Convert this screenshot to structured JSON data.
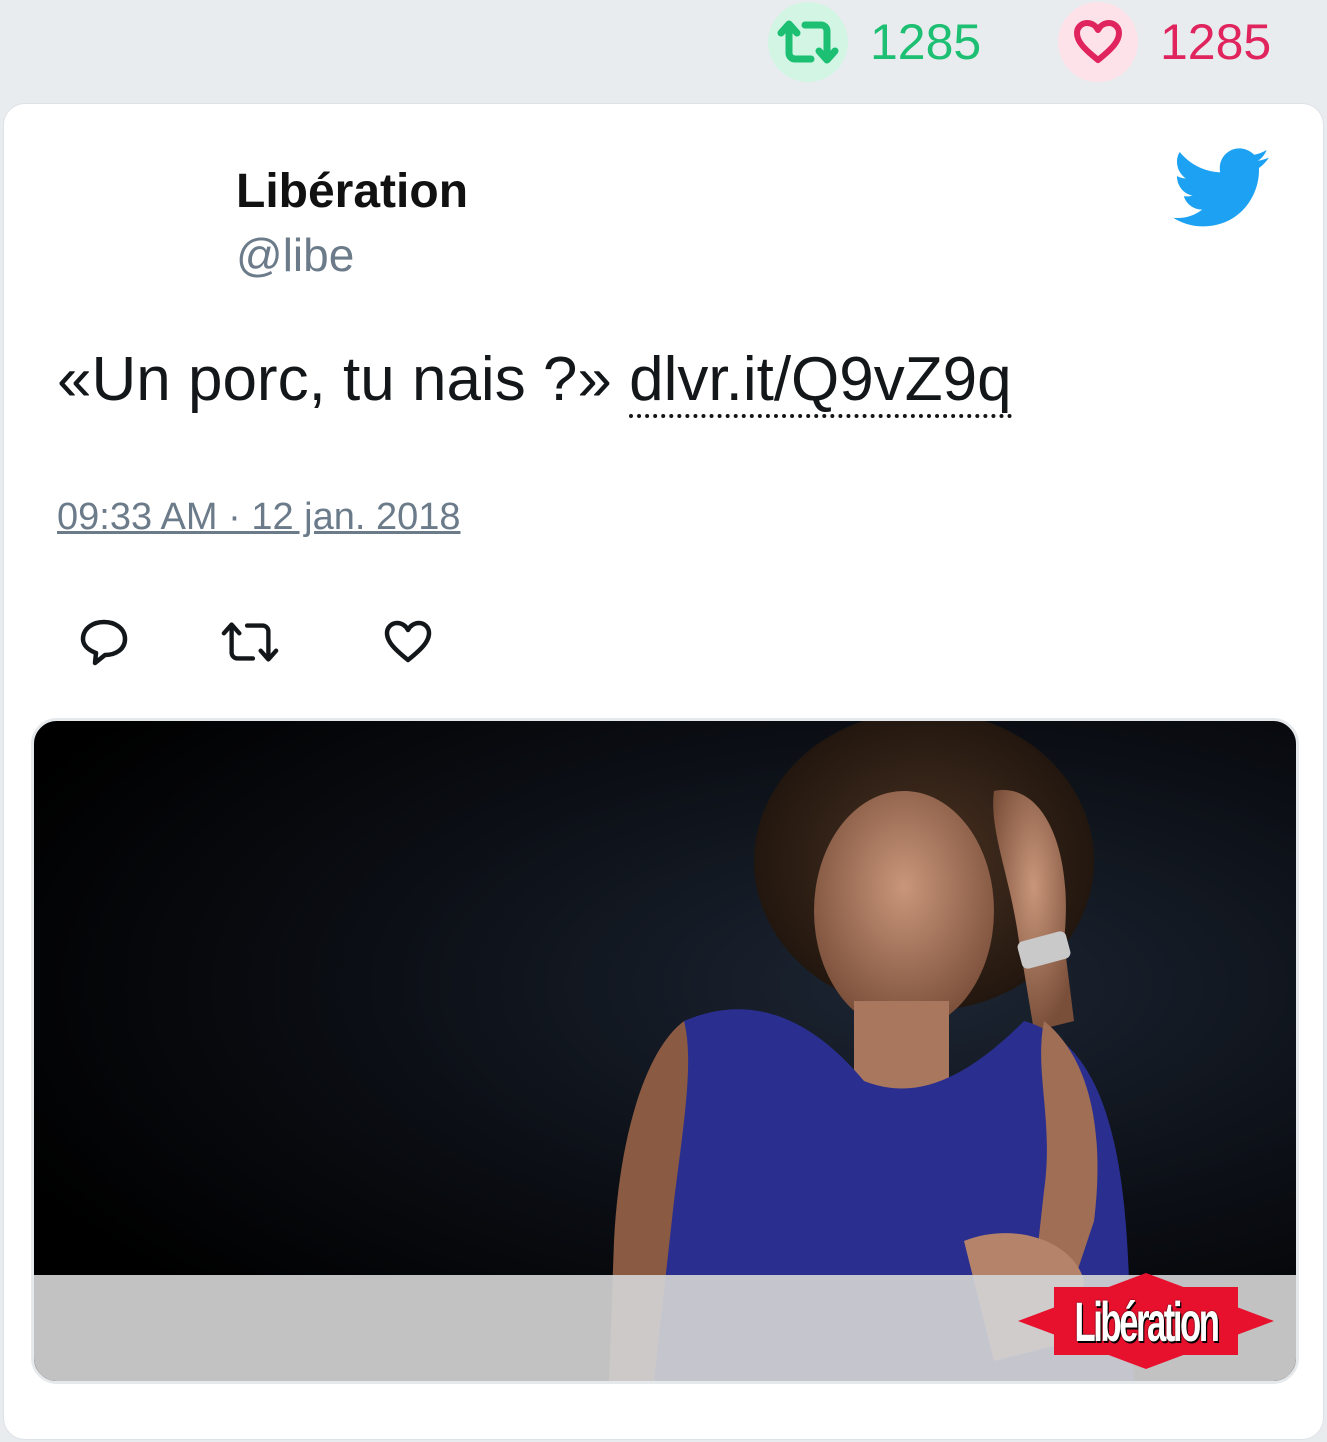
{
  "stats": {
    "retweets": "1285",
    "likes": "1285"
  },
  "tweet": {
    "display_name": "Libération",
    "handle": "@libe",
    "text": "«Un porc, tu nais ?» ",
    "link": "dlvr.it/Q9vZ9q",
    "timestamp": "09:33 AM · 12 jan. 2018",
    "media_logo": "Libération"
  },
  "colors": {
    "retweet_green": "#1dbf73",
    "like_red": "#e0245e",
    "twitter_blue": "#1da1f2",
    "meta_gray": "#6b7b8a"
  },
  "icons": [
    "retweet-icon",
    "heart-icon",
    "twitter-bird-icon",
    "reply-icon"
  ]
}
